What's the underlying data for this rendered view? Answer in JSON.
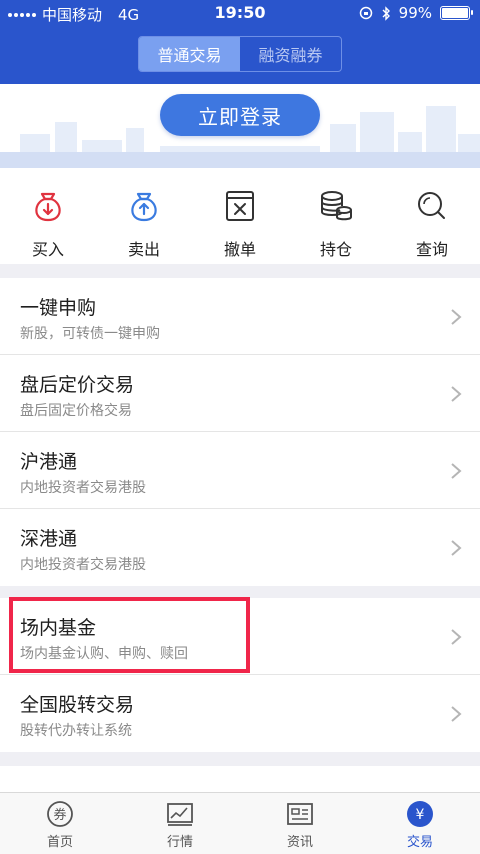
{
  "status_bar": {
    "carrier": "中国移动",
    "network": "4G",
    "time": "19:50",
    "battery": "99%",
    "battery_level": 0.99
  },
  "segment": {
    "options": [
      {
        "label": "普通交易",
        "active": true
      },
      {
        "label": "融资融券",
        "active": false
      }
    ]
  },
  "login": {
    "button_label": "立即登录"
  },
  "quick_actions": [
    {
      "label": "买入",
      "icon": "buy-bag-icon"
    },
    {
      "label": "卖出",
      "icon": "sell-bag-icon"
    },
    {
      "label": "撤单",
      "icon": "cancel-order-icon"
    },
    {
      "label": "持仓",
      "icon": "holdings-coins-icon"
    },
    {
      "label": "查询",
      "icon": "search-icon"
    }
  ],
  "list_groups": [
    {
      "items": [
        {
          "title": "一键申购",
          "subtitle": "新股，可转债一键申购"
        },
        {
          "title": "盘后定价交易",
          "subtitle": "盘后固定价格交易"
        },
        {
          "title": "沪港通",
          "subtitle": "内地投资者交易港股"
        },
        {
          "title": "深港通",
          "subtitle": "内地投资者交易港股"
        }
      ]
    },
    {
      "items": [
        {
          "title": "场内基金",
          "subtitle": "场内基金认购、申购、赎回"
        },
        {
          "title": "全国股转交易",
          "subtitle": "股转代办转让系统"
        }
      ]
    }
  ],
  "tabbar": [
    {
      "label": "首页",
      "icon": "coupon-home-icon",
      "active": false
    },
    {
      "label": "行情",
      "icon": "market-chart-icon",
      "active": false
    },
    {
      "label": "资讯",
      "icon": "news-icon",
      "active": false
    },
    {
      "label": "交易",
      "icon": "yuan-trade-icon",
      "active": true
    }
  ],
  "colors": {
    "header_blue": "#2a55cc",
    "accent_blue": "#3e77e0",
    "buy_red": "#e0333f",
    "sell_blue": "#3a7be0",
    "highlight_red": "#f0264a"
  }
}
